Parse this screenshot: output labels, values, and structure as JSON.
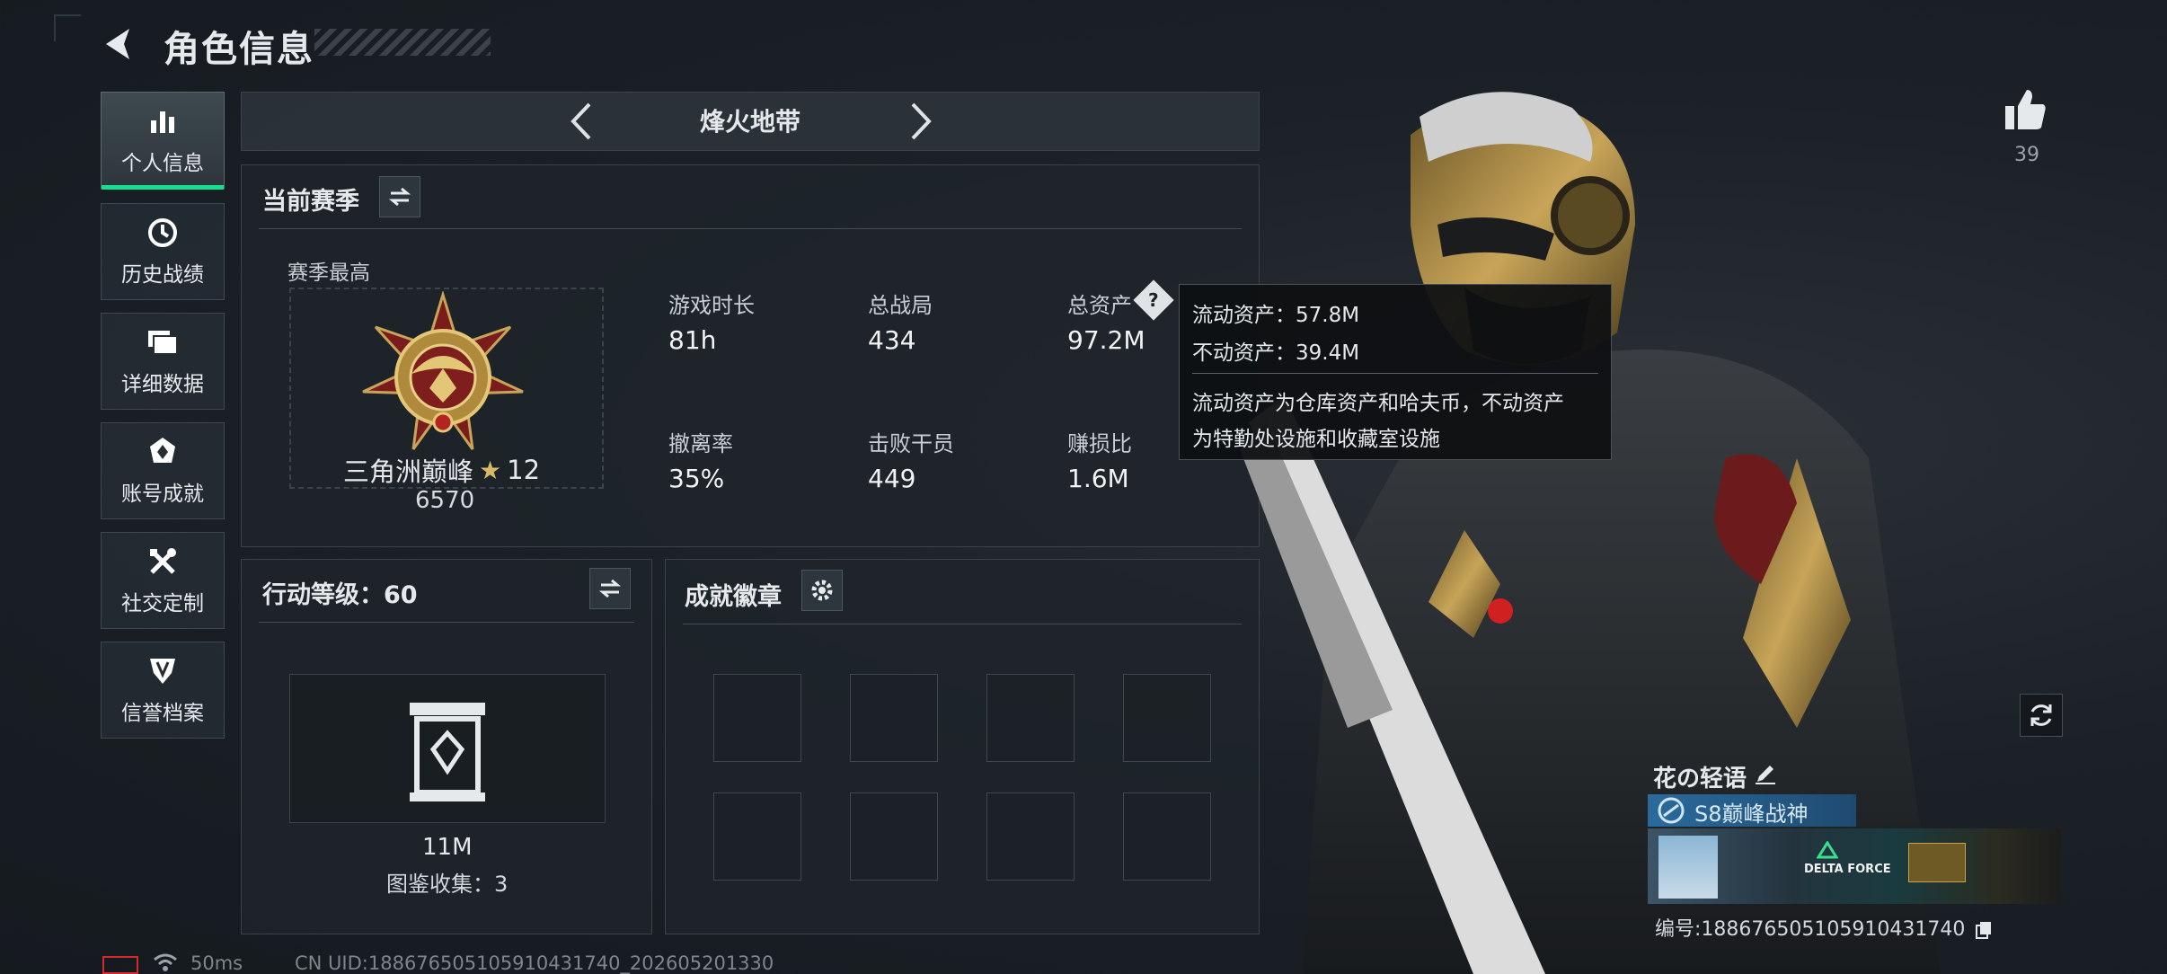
{
  "header": {
    "title": "角色信息"
  },
  "sidebar": {
    "items": [
      {
        "label": "个人信息",
        "icon": "bar-chart-icon",
        "active": true
      },
      {
        "label": "历史战绩",
        "icon": "history-clock-icon"
      },
      {
        "label": "详细数据",
        "icon": "folder-icon"
      },
      {
        "label": "账号成就",
        "icon": "achievement-badge-icon"
      },
      {
        "label": "社交定制",
        "icon": "tools-icon"
      },
      {
        "label": "信誉档案",
        "icon": "credit-shield-icon"
      }
    ]
  },
  "mode": {
    "label": "烽火地带"
  },
  "season": {
    "title": "当前赛季",
    "best_label": "赛季最高",
    "rank_name": "三角洲巅峰",
    "rank_stars": "12",
    "rank_points": "6570",
    "stats": [
      {
        "label": "游戏时长",
        "value": "81h"
      },
      {
        "label": "总战局",
        "value": "434"
      },
      {
        "label": "总资产",
        "value": "97.2M"
      },
      {
        "label": "撤离率",
        "value": "35%"
      },
      {
        "label": "击败干员",
        "value": "449"
      },
      {
        "label": "赚损比",
        "value": "1.6M"
      }
    ]
  },
  "tooltip": {
    "liquid": "流动资产：57.8M",
    "fixed": "不动资产：39.4M",
    "desc1": "流动资产为仓库资产和哈夫币，不动资产",
    "desc2": "为特勤处设施和收藏室设施"
  },
  "action": {
    "title": "行动等级：60",
    "value": "11M",
    "collection": "图鉴收集：3"
  },
  "badges": {
    "title": "成就徽章"
  },
  "profile": {
    "like_count": "39",
    "player_name": "花の轻语",
    "title_text": "S8巅峰战神",
    "id_text": "编号:1886765051059104317​40",
    "banner_text": "DELTA FORCE"
  },
  "footer": {
    "ping": "50ms",
    "uid": "CN UID:1886765051059104317​40_202605201330"
  },
  "colors": {
    "accent": "#16e08e",
    "tooltip_bg": "#0e1012",
    "title_strip": "#2b6b9c"
  }
}
